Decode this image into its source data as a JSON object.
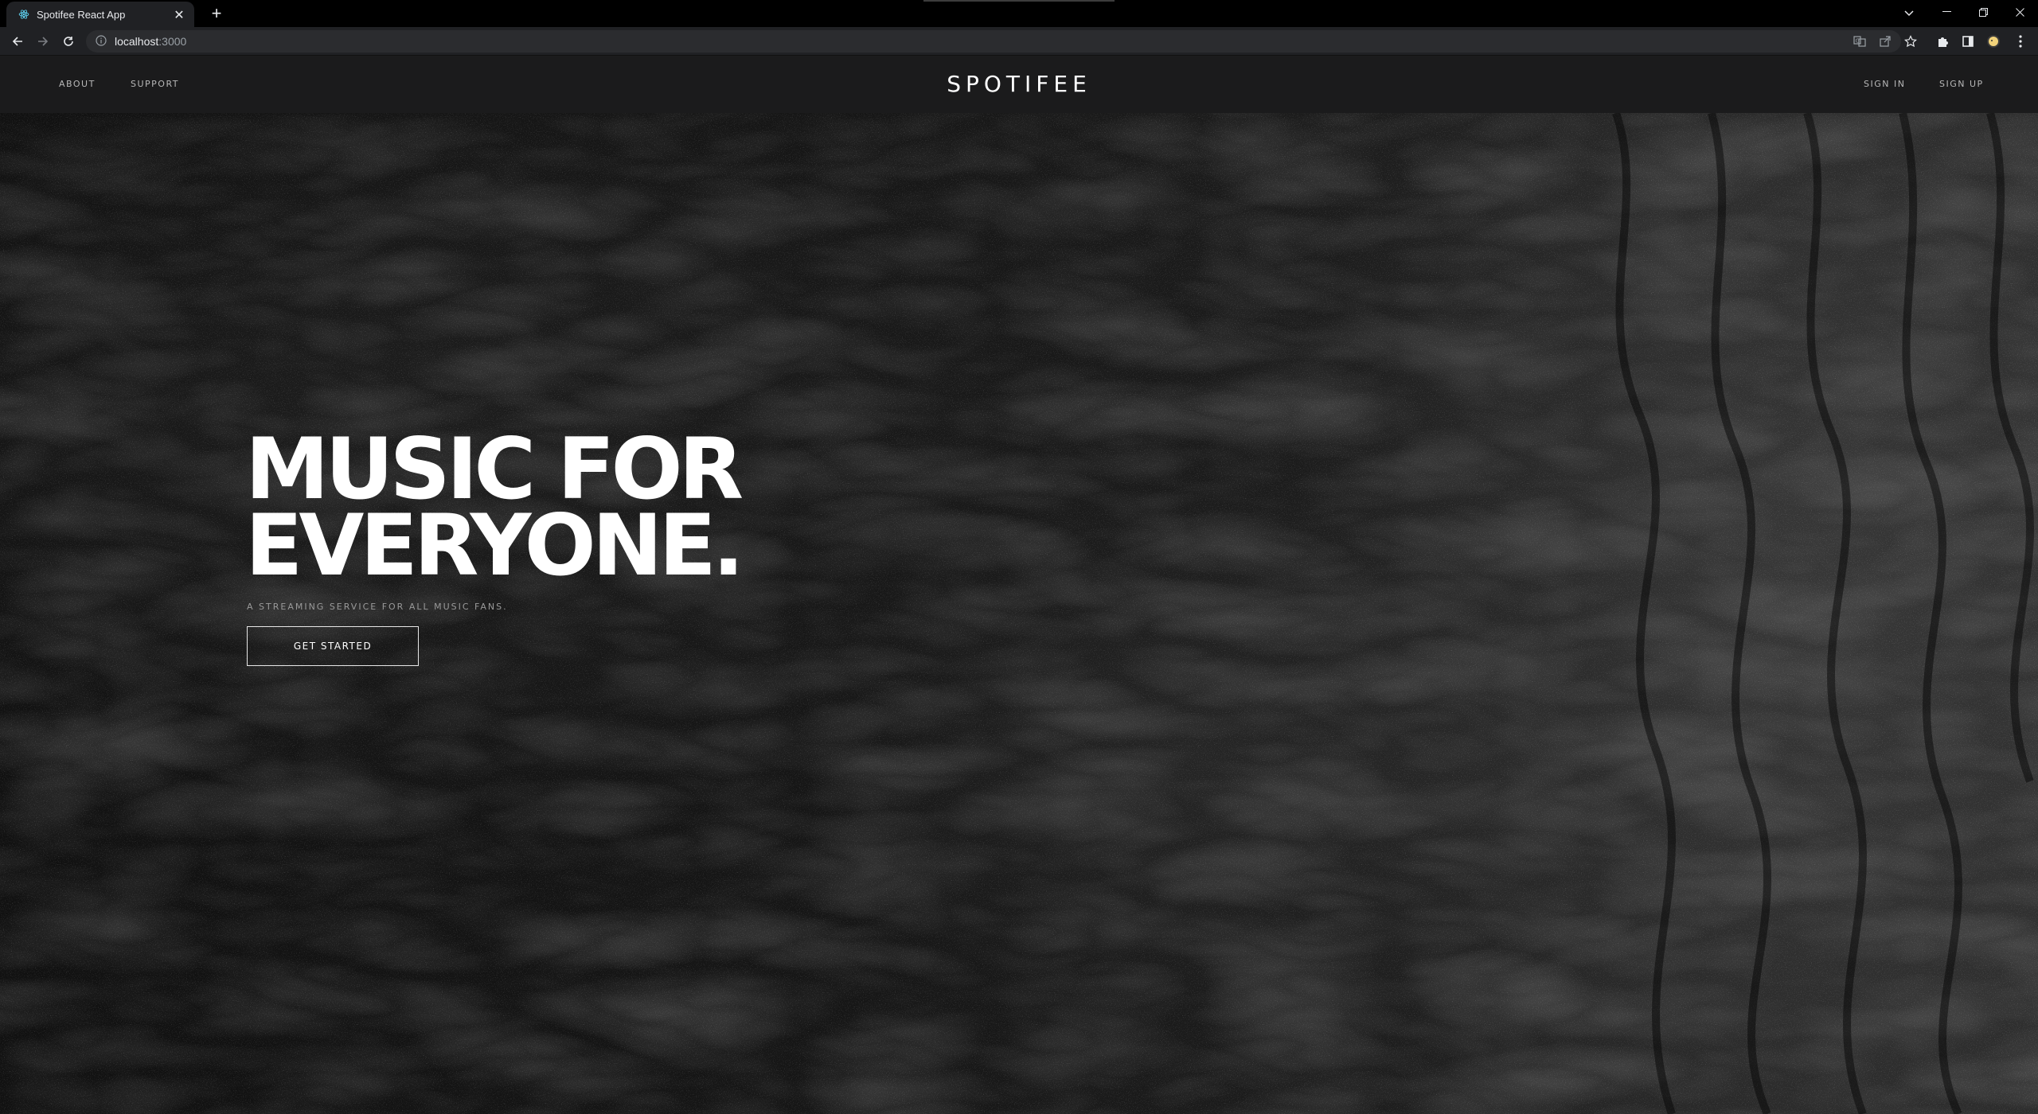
{
  "browser": {
    "tab_title": "Spotifee React App",
    "url_host": "localhost",
    "url_port": ":3000",
    "tab_icon": "react-icon",
    "colors": {
      "chrome_dark": "#000000",
      "toolbar": "#202124",
      "omnibox": "#2b2c2f"
    }
  },
  "nav": {
    "left": [
      "ABOUT",
      "SUPPORT"
    ],
    "brand": "SPOTIFEE",
    "right": [
      "SIGN IN",
      "SIGN UP"
    ]
  },
  "hero": {
    "title_line1": "MUSIC FOR",
    "title_line2": "EVERYONE.",
    "subtitle": "A STREAMING SERVICE FOR ALL MUSIC FANS.",
    "cta_label": "GET STARTED",
    "background": "dark-sand-texture",
    "colors": {
      "header_bg": "#1b1b1c",
      "title": "#ffffff",
      "subtitle": "#9a9a9a"
    }
  }
}
